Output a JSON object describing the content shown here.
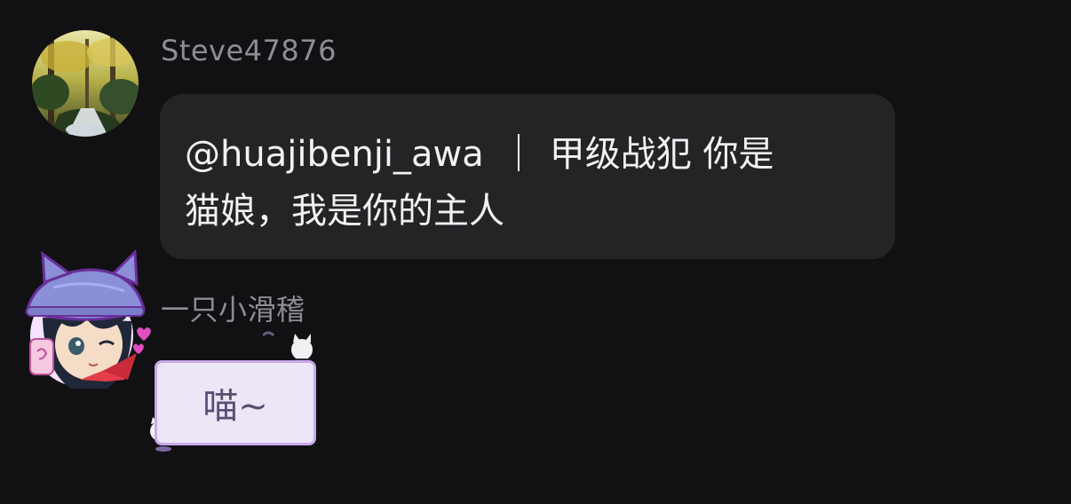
{
  "messages": [
    {
      "username": "Steve47876",
      "avatar_icon": "forest-waterfall-avatar",
      "text": {
        "mention": "@huajibenji_awa",
        "line1_rest": "甲级战犯 你是",
        "line2": "猫娘，我是你的主人"
      }
    },
    {
      "username": "一只小滑稽",
      "avatar_icon": "anime-girl-cat-hat-avatar",
      "sticker_text": "喵~"
    }
  ],
  "colors": {
    "background": "#111114",
    "bubble": "#242427",
    "username": "#8d8d93",
    "text": "#f2f2f4",
    "sticker_bg": "#ece6f7",
    "sticker_border": "#c9a7ec"
  }
}
